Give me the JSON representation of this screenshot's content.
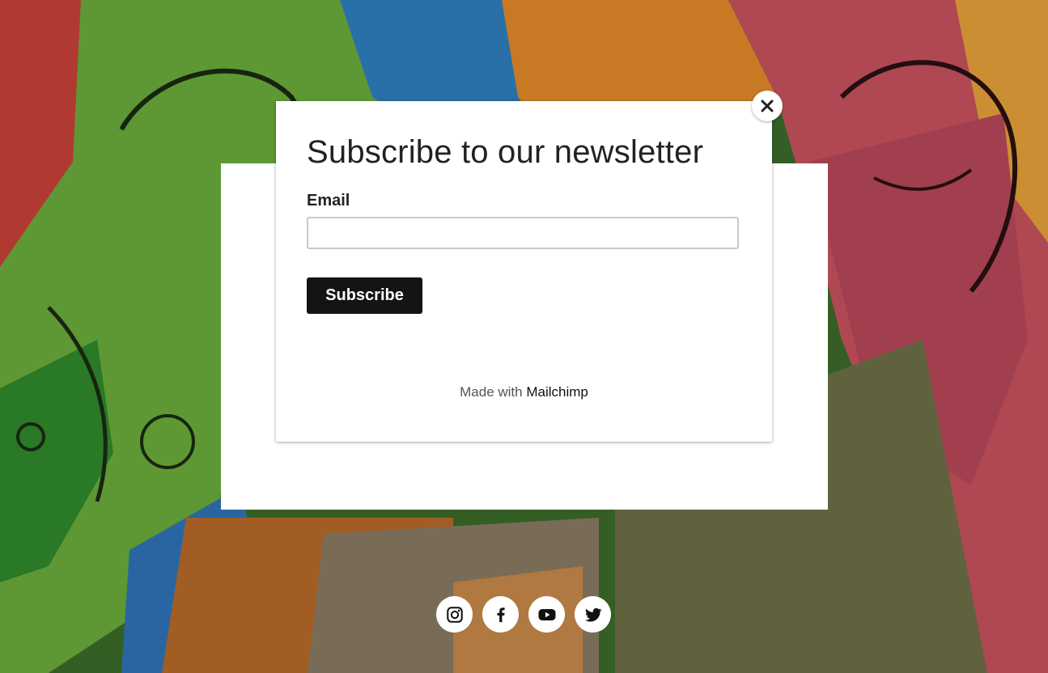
{
  "modal": {
    "title": "Subscribe to our newsletter",
    "email_label": "Email",
    "email_value": "",
    "email_placeholder": "",
    "subscribe_label": "Subscribe",
    "made_with_prefix": "Made with",
    "made_with_brand": "Mailchimp",
    "close_icon": "close-icon"
  },
  "social": [
    {
      "icon": "instagram-icon"
    },
    {
      "icon": "facebook-icon"
    },
    {
      "icon": "youtube-icon"
    },
    {
      "icon": "twitter-icon"
    }
  ],
  "colors": {
    "button_bg": "#141414",
    "button_text": "#ffffff",
    "input_border": "#c9c9c9",
    "text": "#222222"
  }
}
